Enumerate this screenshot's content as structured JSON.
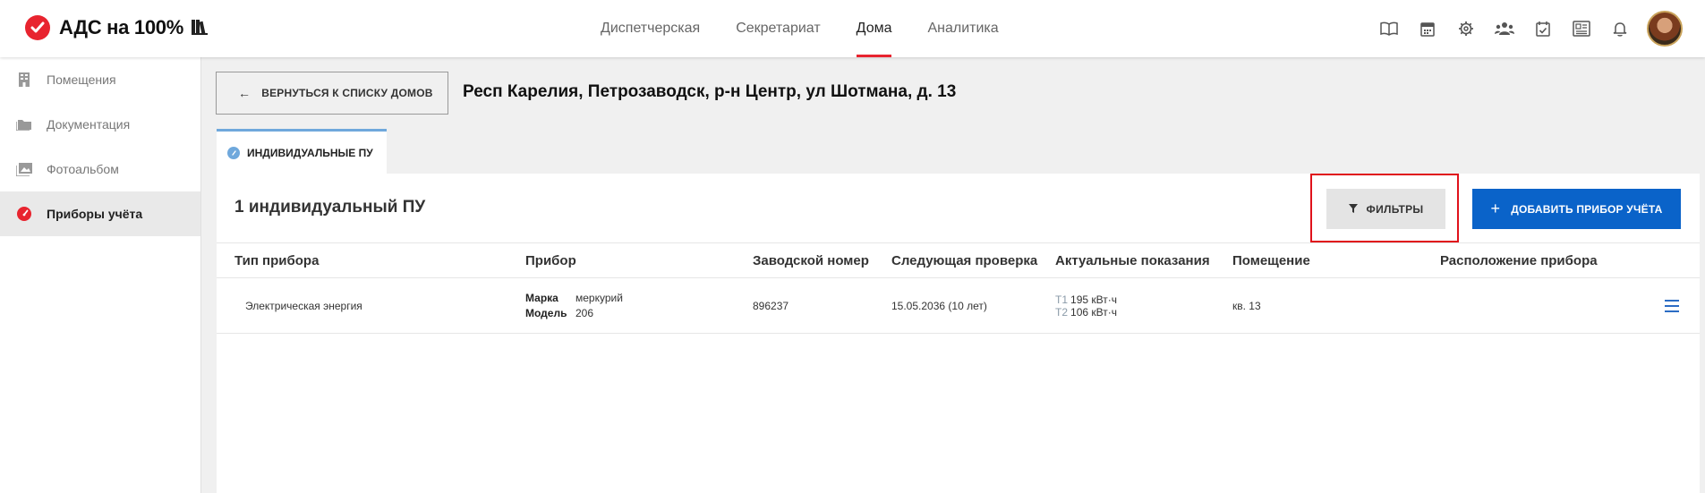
{
  "header": {
    "app_title": "АДС на 100%",
    "nav": [
      {
        "label": "Диспетчерская",
        "active": false
      },
      {
        "label": "Секретариат",
        "active": false
      },
      {
        "label": "Дома",
        "active": true
      },
      {
        "label": "Аналитика",
        "active": false
      }
    ],
    "icons": [
      "book-icon",
      "calendar-icon",
      "gear-icon",
      "users-icon",
      "calendar-check-icon",
      "newspaper-icon",
      "bell-icon"
    ],
    "accent_color": "#e8242f"
  },
  "sidebar": {
    "items": [
      {
        "label": "Помещения",
        "icon": "building-icon",
        "active": false
      },
      {
        "label": "Документация",
        "icon": "folder-icon",
        "active": false
      },
      {
        "label": "Фотоальбом",
        "icon": "photo-icon",
        "active": false
      },
      {
        "label": "Приборы учёта",
        "icon": "gauge-icon",
        "active": true
      }
    ]
  },
  "main": {
    "back_label": "ВЕРНУТЬСЯ К СПИСКУ ДОМОВ",
    "address": "Респ Карелия, Петрозаводск, р-н Центр, ул Шотмана, д. 13",
    "tab_label": "ИНДИВИДУАЛЬНЫЕ ПУ",
    "count_label": "1 индивидуальный ПУ",
    "filter_label": "ФИЛЬТРЫ",
    "add_label": "ДОБАВИТЬ ПРИБОР УЧЁТА",
    "columns": [
      "Тип прибора",
      "Прибор",
      "Заводской номер",
      "Следующая проверка",
      "Актуальные показания",
      "Помещение",
      "Расположение прибора"
    ],
    "rows": [
      {
        "type": "Электрическая энергия",
        "brand_key": "Марка",
        "brand": "меркурий",
        "model_key": "Модель",
        "model": "206",
        "serial": "896237",
        "next_check": "15.05.2036 (10 лет)",
        "t1_key": "Т1",
        "t1": "195 кВт·ч",
        "t2_key": "Т2",
        "t2": "106 кВт·ч",
        "room": "кв. 13",
        "location": ""
      }
    ]
  }
}
